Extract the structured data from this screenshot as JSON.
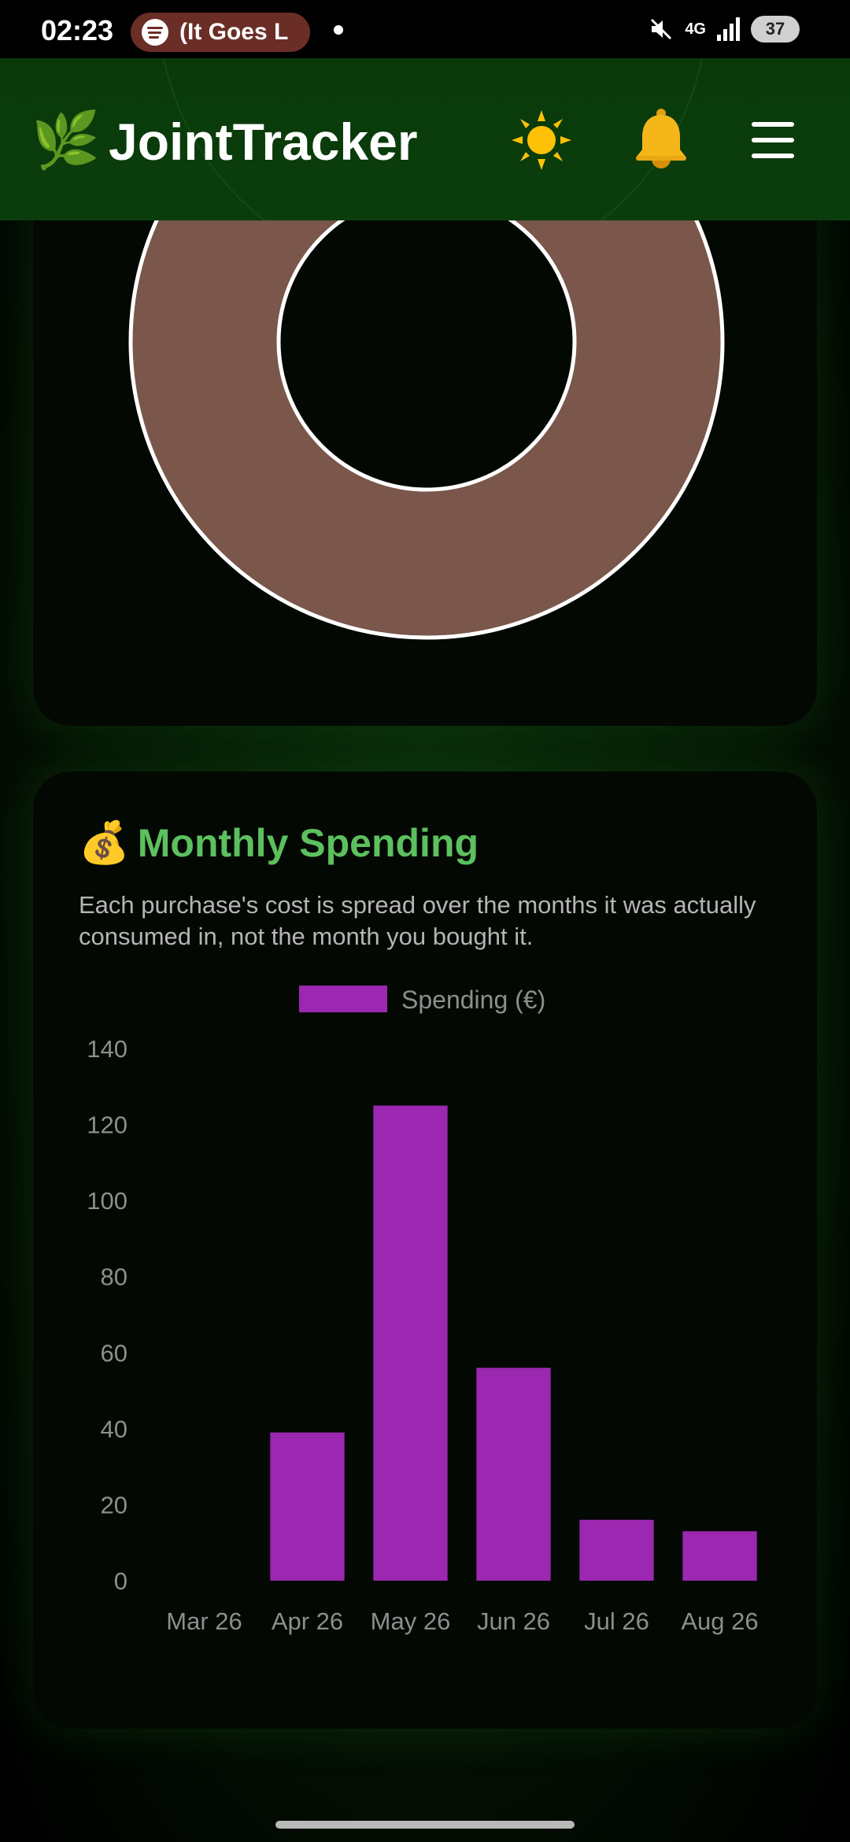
{
  "status_bar": {
    "time": "02:23",
    "media_text": "(It Goes L",
    "network": "4G",
    "battery": "37"
  },
  "header": {
    "logo_icon": "🌿",
    "title": "JointTracker",
    "theme_icon": "☀️",
    "notifications_icon": "🔔",
    "menu_icon": "hamburger-menu-icon"
  },
  "donut_chart": {
    "colors": {
      "slice": "#7a564b",
      "border": "#ffffff"
    },
    "slices": [
      {
        "value": 100
      }
    ]
  },
  "spending_card": {
    "icon": "💰",
    "title": "Monthly Spending",
    "description": "Each purchase's cost is spread over the months it was actually consumed in, not the month you bought it."
  },
  "colors": {
    "accent_green": "#5cc05e",
    "bar_purple": "#9c27b0",
    "header_bg": "#0b3d0c"
  },
  "chart_data": {
    "type": "bar",
    "categories": [
      "Mar 26",
      "Apr 26",
      "May 26",
      "Jun 26",
      "Jul 26",
      "Aug 26"
    ],
    "series": [
      {
        "name": "Spending (€)",
        "values": [
          0,
          39,
          125,
          56,
          16,
          13
        ]
      }
    ],
    "ylim": [
      0,
      140
    ],
    "yticks": [
      0,
      20,
      40,
      60,
      80,
      100,
      120,
      140
    ],
    "legend": "top-center",
    "grid": false
  }
}
